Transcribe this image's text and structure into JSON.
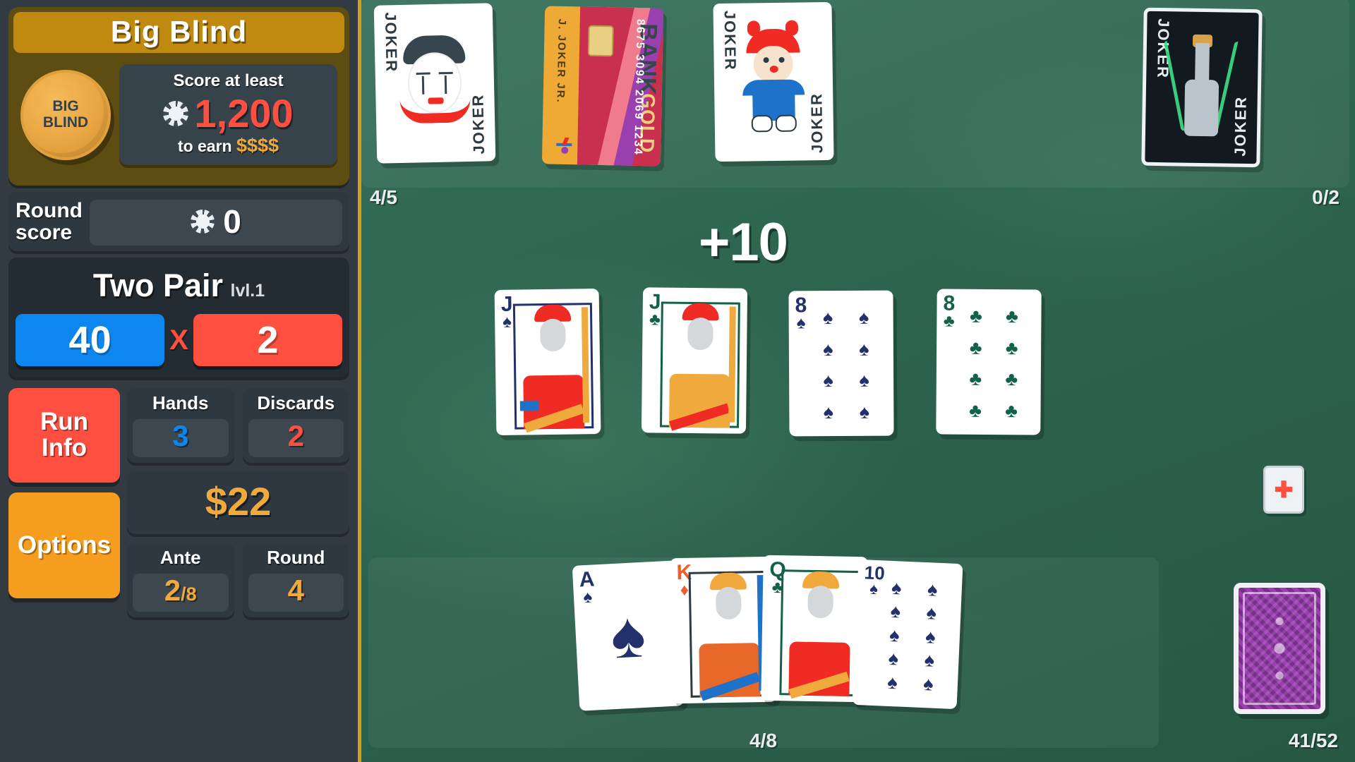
{
  "sidebar": {
    "blind": {
      "title": "Big Blind",
      "chip_line1": "BIG",
      "chip_line2": "BLIND",
      "requirement_label": "Score at least",
      "requirement_score": "1,200",
      "reward_prefix": "to earn",
      "reward": "$$$$"
    },
    "round_score": {
      "label_line1": "Round",
      "label_line2": "score",
      "value": "0"
    },
    "hand": {
      "name": "Two Pair",
      "level": "lvl.1",
      "chips": "40",
      "times_symbol": "X",
      "mult": "2"
    },
    "buttons": {
      "run_info": "Run\nInfo",
      "run_info_line1": "Run",
      "run_info_line2": "Info",
      "options": "Options"
    },
    "stats": {
      "hands_label": "Hands",
      "hands_value": "3",
      "discards_label": "Discards",
      "discards_value": "2",
      "money": "$22",
      "ante_label": "Ante",
      "ante_value": "2",
      "ante_sep": "/",
      "ante_max": "8",
      "round_label": "Round",
      "round_value": "4"
    }
  },
  "table": {
    "joker_counter": "4/5",
    "consumable_counter": "0/2",
    "hand_counter": "4/8",
    "deck_counter": "41/52",
    "score_popup": "+10",
    "jokers": [
      {
        "name": "mime-joker",
        "label": "JOKER"
      },
      {
        "name": "credit-card-joker",
        "bank": "BANK",
        "tier": "GOLD",
        "holder": "J. JOKER JR.",
        "number": "8675 3094 2069 1234"
      },
      {
        "name": "jester-joker",
        "label": "JOKER"
      },
      {
        "name": "bottle-joker",
        "label": "JOKER"
      }
    ],
    "played_cards": [
      {
        "rank": "J",
        "suit": "spade",
        "glyph": "♠"
      },
      {
        "rank": "J",
        "suit": "club",
        "glyph": "♣"
      },
      {
        "rank": "8",
        "suit": "spade",
        "glyph": "♠"
      },
      {
        "rank": "8",
        "suit": "club",
        "glyph": "♣"
      }
    ],
    "hand_cards": [
      {
        "rank": "A",
        "suit": "spade",
        "glyph": "♠"
      },
      {
        "rank": "K",
        "suit": "diamond",
        "glyph": "♦"
      },
      {
        "rank": "Q",
        "suit": "club",
        "glyph": "♣"
      },
      {
        "rank": "10",
        "suit": "spade",
        "glyph": "♠"
      }
    ]
  },
  "colors": {
    "blue_chips": "#0d86f0",
    "red_mult": "#fe4f41",
    "gold": "#f0a93c",
    "blind_gold": "#c08a10",
    "table_green": "#2e6650"
  }
}
